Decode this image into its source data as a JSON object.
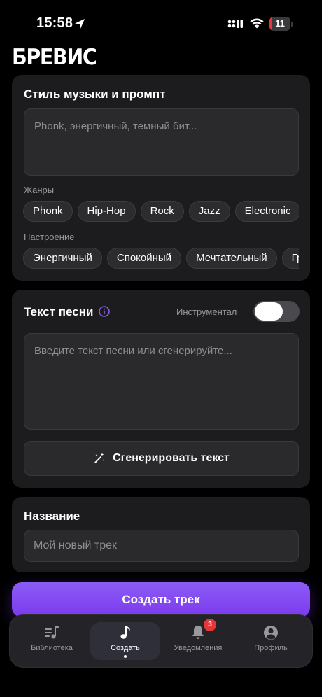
{
  "status_bar": {
    "time": "15:58",
    "battery_level": "11",
    "battery_fraction": 0.11,
    "battery_color": "#e5373a",
    "icons": [
      "location-arrow-icon",
      "signal-icon",
      "wifi-icon",
      "battery-icon"
    ]
  },
  "app": {
    "logo_text": "БРЕВИС"
  },
  "style_card": {
    "title": "Стиль музыки и промпт",
    "prompt_placeholder": "Phonk, энергичный, темный бит...",
    "genres_label": "Жанры",
    "genres": [
      "Phonk",
      "Hip-Hop",
      "Rock",
      "Jazz",
      "Electronic",
      ""
    ],
    "mood_label": "Настроение",
    "moods": [
      "Энергичный",
      "Спокойный",
      "Мечтательный",
      "Груст"
    ]
  },
  "lyrics_card": {
    "title": "Текст песни",
    "instrumental_label": "Инструментал",
    "instrumental_on": false,
    "lyrics_placeholder": "Введите текст песни или сгенерируйте...",
    "generate_label": "Сгенерировать текст"
  },
  "name_card": {
    "title": "Название",
    "name_placeholder": "Мой новый трек"
  },
  "create_button": {
    "label": "Создать трек",
    "color": "#8b5cf6"
  },
  "tab_bar": {
    "tabs": [
      {
        "label": "Библиотека",
        "icon": "library-icon"
      },
      {
        "label": "Создать",
        "icon": "music-note-icon",
        "active": true
      },
      {
        "label": "Уведомления",
        "icon": "bell-icon",
        "badge": "3"
      },
      {
        "label": "Профиль",
        "icon": "profile-icon"
      }
    ]
  }
}
